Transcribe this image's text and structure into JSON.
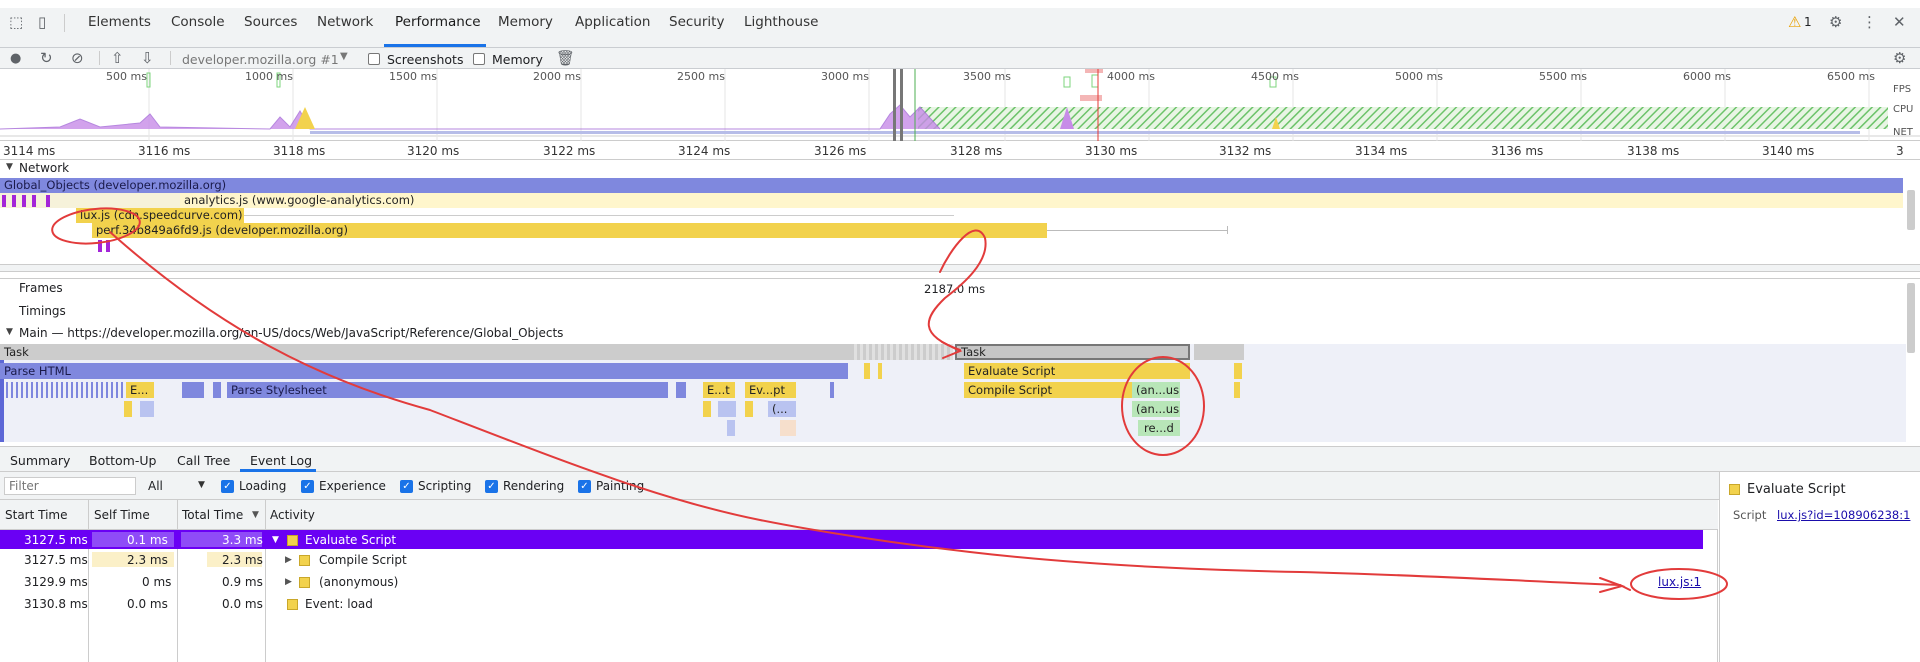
{
  "tabs": [
    "Elements",
    "Console",
    "Sources",
    "Network",
    "Performance",
    "Memory",
    "Application",
    "Security",
    "Lighthouse"
  ],
  "active_tab": "Performance",
  "warning_count": "1",
  "toolbar": {
    "profile": "developer.mozilla.org #1",
    "screenshots_label": "Screenshots",
    "memory_label": "Memory"
  },
  "overview": {
    "ticks": [
      "500 ms",
      "1000 ms",
      "1500 ms",
      "2000 ms",
      "2500 ms",
      "3000 ms",
      "3500 ms",
      "4000 ms",
      "4500 ms",
      "5000 ms",
      "5500 ms",
      "6000 ms",
      "6500 ms"
    ],
    "lanes": [
      "FPS",
      "CPU",
      "NET"
    ]
  },
  "time_ruler": [
    "3114 ms",
    "3116 ms",
    "3118 ms",
    "3120 ms",
    "3122 ms",
    "3124 ms",
    "3126 ms",
    "3128 ms",
    "3130 ms",
    "3132 ms",
    "3134 ms",
    "3136 ms",
    "3138 ms",
    "3140 ms",
    "3"
  ],
  "network": {
    "label": "Network",
    "requests": [
      {
        "name": "Global_Objects (developer.mozilla.org)",
        "color": "#7f88de"
      },
      {
        "name": "analytics.js (www.google-analytics.com)",
        "color": "#fff6cc"
      },
      {
        "name": "lux.js (cdn.speedcurve.com)",
        "color": "#f2d24d"
      },
      {
        "name": "perf.34b849a6fd9.js (developer.mozilla.org)",
        "color": "#f2d24d"
      }
    ]
  },
  "tracks": {
    "frames": "Frames",
    "frames_time": "2187.0 ms",
    "timings": "Timings",
    "main": "Main — https://developer.mozilla.org/en-US/docs/Web/JavaScript/Reference/Global_Objects"
  },
  "flame": {
    "task": "Task",
    "task2": "Task",
    "parse_html": "Parse HTML",
    "e1": "E...",
    "parse_stylesheet": "Parse Stylesheet",
    "e2": "E...t",
    "ev": "Ev...pt",
    "paren": "(...",
    "evaluate": "Evaluate Script",
    "compile": "Compile Script",
    "an1": "(an...us)",
    "an2": "(an...us)",
    "red": "re...d"
  },
  "bottom_tabs": [
    "Summary",
    "Bottom-Up",
    "Call Tree",
    "Event Log"
  ],
  "active_bottom_tab": "Event Log",
  "filter": {
    "placeholder": "Filter",
    "select": "All",
    "categories": [
      "Loading",
      "Experience",
      "Scripting",
      "Rendering",
      "Painting"
    ]
  },
  "columns": [
    "Start Time",
    "Self Time",
    "Total Time",
    "Activity"
  ],
  "rows": [
    {
      "start": "3127.5 ms",
      "self": "0.1 ms",
      "total": "3.3 ms",
      "activity": "Evaluate Script"
    },
    {
      "start": "3127.5 ms",
      "self": "2.3 ms",
      "total": "2.3 ms",
      "activity": "Compile Script"
    },
    {
      "start": "3129.9 ms",
      "self": "0 ms",
      "total": "0.9 ms",
      "activity": "(anonymous)",
      "link": "lux.js:1"
    },
    {
      "start": "3130.8 ms",
      "self": "0.0 ms",
      "total": "0.0 ms",
      "activity": "Event: load"
    }
  ],
  "details": {
    "title": "Evaluate Script",
    "script_label": "Script",
    "script_link": "lux.js?id=108906238:1"
  },
  "colors": {
    "accent": "#1a73e8",
    "selected_row": "#6a00f4",
    "script": "#f2d24d",
    "parse": "#7f88de",
    "annotation": "#e23b3b"
  }
}
